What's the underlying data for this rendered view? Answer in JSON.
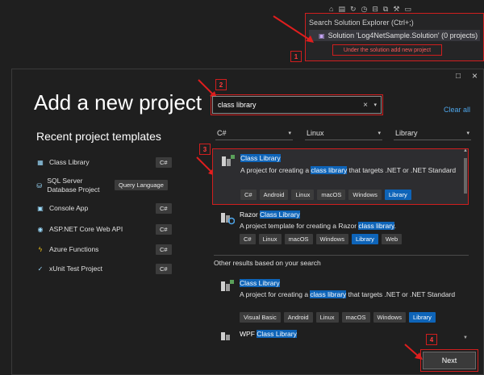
{
  "solution_explorer": {
    "search_placeholder": "Search Solution Explorer (Ctrl+;)",
    "solution_label": "Solution 'Log4NetSample.Solution' (0 projects)",
    "hint": "Under the solution add new project",
    "step": "1"
  },
  "dialog": {
    "title": "Add a new project",
    "recent_title": "Recent project templates",
    "recent": [
      {
        "label": "Class Library",
        "lang": "C#"
      },
      {
        "label": "SQL Server Database Project",
        "lang": "Query Language"
      },
      {
        "label": "Console App",
        "lang": "C#"
      },
      {
        "label": "ASP.NET Core Web API",
        "lang": "C#"
      },
      {
        "label": "Azure Functions",
        "lang": "C#"
      },
      {
        "label": "xUnit Test Project",
        "lang": "C#"
      }
    ],
    "search_value": "class library",
    "step_search": "2",
    "clear_all": "Clear all",
    "filters": {
      "language": "C#",
      "platform": "Linux",
      "type": "Library"
    },
    "step_select": "3",
    "results": [
      {
        "name": "Class Library",
        "desc_pre": "A project for creating a ",
        "desc_hl": "class library",
        "desc_post": " that targets .NET or .NET Standard",
        "tags": [
          "C#",
          "Android",
          "Linux",
          "macOS",
          "Windows",
          "Library"
        ]
      },
      {
        "name_pre": "Razor ",
        "name_hl": "Class Library",
        "desc_pre": "A project template for creating a Razor ",
        "desc_hl": "class library",
        "desc_post": ".",
        "tags": [
          "C#",
          "Linux",
          "macOS",
          "Windows",
          "Library",
          "Web"
        ]
      }
    ],
    "other_header": "Other results based on your search",
    "other": [
      {
        "name": "Class Library",
        "desc_pre": "A project for creating a ",
        "desc_hl": "class library",
        "desc_post": " that targets .NET or .NET Standard",
        "tags": [
          "Visual Basic",
          "Android",
          "Linux",
          "macOS",
          "Windows",
          "Library"
        ]
      },
      {
        "name_pre": "WPF ",
        "name_hl": "Class Library"
      }
    ],
    "step_next": "4",
    "next_label": "Next"
  },
  "colors": {
    "accent": "#0e64b8",
    "annotation": "#d01e1e",
    "link": "#4ea6ea"
  }
}
